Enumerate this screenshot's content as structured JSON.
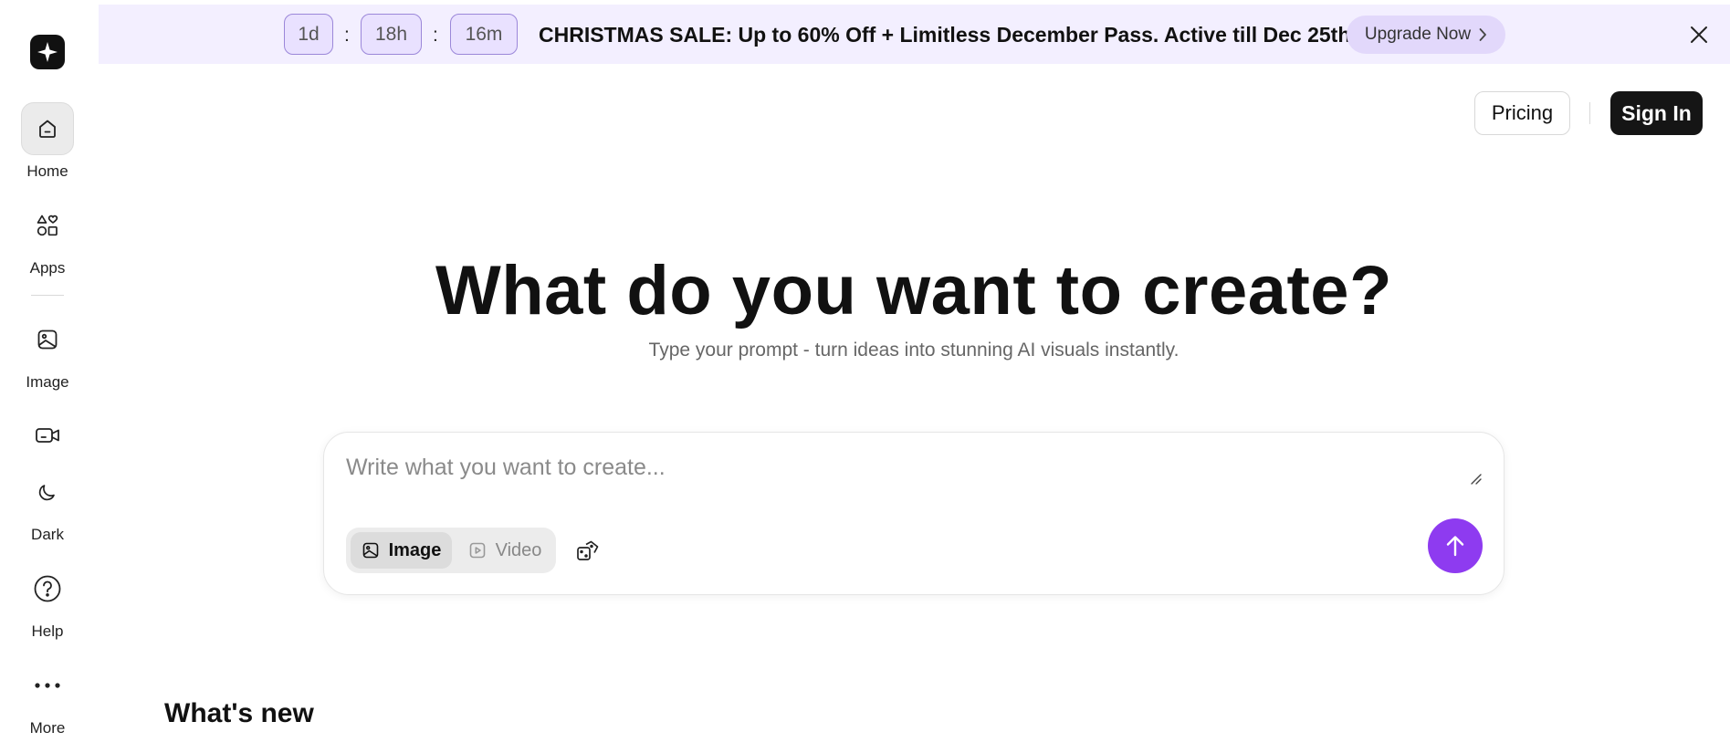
{
  "sidebar": {
    "logo_icon": "brand-sparkle-logo",
    "items": [
      {
        "label": "Home",
        "icon": "home-icon",
        "active": true
      },
      {
        "label": "Apps",
        "icon": "apps-shapes-icon"
      },
      {
        "label": "Image",
        "icon": "image-icon"
      },
      {
        "label": "",
        "icon": "video-icon"
      },
      {
        "label": "Dark",
        "icon": "moon-icon"
      },
      {
        "label": "Help",
        "icon": "help-icon"
      },
      {
        "label": "More",
        "icon": "more-dots-icon"
      }
    ]
  },
  "banner": {
    "timer": {
      "days": "1d",
      "hours": "18h",
      "minutes": "16m",
      "separator": ":"
    },
    "text": "CHRISTMAS SALE: Up to 60% Off + Limitless December Pass. Active till Dec 25th.",
    "cta": "Upgrade Now",
    "background": "#f3efff"
  },
  "header": {
    "pricing": "Pricing",
    "signin": "Sign In"
  },
  "hero": {
    "title": "What do you want to create?",
    "subtitle": "Type your prompt - turn ideas into stunning AI visuals instantly."
  },
  "prompt": {
    "placeholder": "Write what you want to create...",
    "value": "",
    "modes": [
      {
        "label": "Image",
        "icon": "image-icon",
        "selected": true
      },
      {
        "label": "Video",
        "icon": "video-play-icon",
        "selected": false
      }
    ],
    "random_icon": "dice-icon",
    "send_icon": "arrow-up-icon",
    "accent": "#8e3bf0"
  },
  "sections": {
    "whats_new": "What's new"
  }
}
